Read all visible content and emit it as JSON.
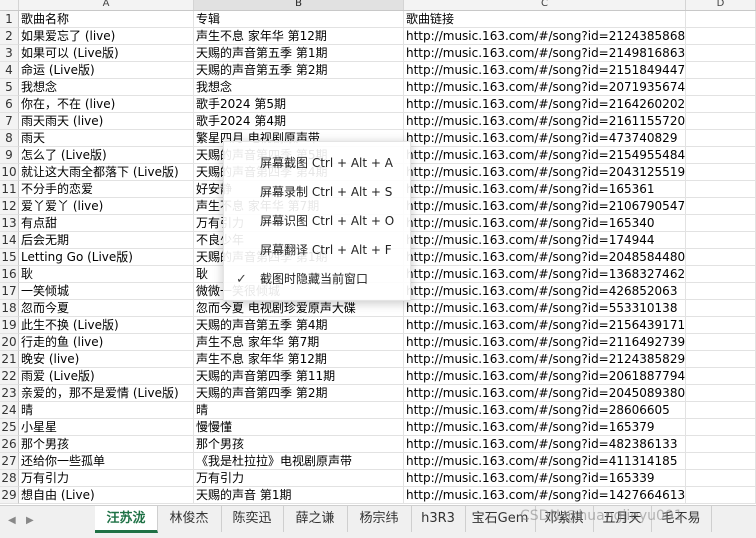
{
  "columns": [
    "A",
    "B",
    "C",
    "D"
  ],
  "selected_column": "B",
  "rows": [
    {
      "n": "1",
      "a": "歌曲名称",
      "b": "专辑",
      "c": "歌曲链接"
    },
    {
      "n": "2",
      "a": "如果爱忘了 (live)",
      "b": "声生不息 家年华 第12期",
      "c": "http://music.163.com/#/song?id=2124385868"
    },
    {
      "n": "3",
      "a": "如果可以 (Live版)",
      "b": "天赐的声音第五季 第1期",
      "c": "http://music.163.com/#/song?id=2149816863"
    },
    {
      "n": "4",
      "a": "命运 (Live版)",
      "b": "天赐的声音第五季 第2期",
      "c": "http://music.163.com/#/song?id=2151849447"
    },
    {
      "n": "5",
      "a": "我想念",
      "b": "我想念",
      "c": "http://music.163.com/#/song?id=2071935674"
    },
    {
      "n": "6",
      "a": "你在，不在 (live)",
      "b": "歌手2024 第5期",
      "c": "http://music.163.com/#/song?id=2164260202"
    },
    {
      "n": "7",
      "a": "雨天雨天 (live)",
      "b": "歌手2024 第4期",
      "c": "http://music.163.com/#/song?id=2161155720"
    },
    {
      "n": "8",
      "a": "雨天",
      "b": "繁星四月 电视剧原声带",
      "c": "http://music.163.com/#/song?id=473740829"
    },
    {
      "n": "9",
      "a": "怎么了 (Live版)",
      "b": "天赐的声音第四季 第5期",
      "c": "http://music.163.com/#/song?id=2154955484"
    },
    {
      "n": "10",
      "a": "就让这大雨全都落下 (Live版)",
      "b": "天赐的声音第四季 第4期",
      "c": "http://music.163.com/#/song?id=2043125519"
    },
    {
      "n": "11",
      "a": "不分手的恋爱",
      "b": "好安静",
      "c": "http://music.163.com/#/song?id=165361"
    },
    {
      "n": "12",
      "a": "爱丫爱丫 (live)",
      "b": "声生不息 家年华 第7期",
      "c": "http://music.163.com/#/song?id=2106790547"
    },
    {
      "n": "13",
      "a": "有点甜",
      "b": "万有引力",
      "c": "http://music.163.com/#/song?id=165340"
    },
    {
      "n": "14",
      "a": "后会无期",
      "b": "不良少年",
      "c": "http://music.163.com/#/song?id=174944"
    },
    {
      "n": "15",
      "a": "Letting Go (Live版)",
      "b": "天赐的声音第四季 第1期",
      "c": "http://music.163.com/#/song?id=2048584480"
    },
    {
      "n": "16",
      "a": "耿",
      "b": "耿",
      "c": "http://music.163.com/#/song?id=1368327462"
    },
    {
      "n": "17",
      "a": "一笑倾城",
      "b": "微微一笑很倾城",
      "c": "http://music.163.com/#/song?id=426852063"
    },
    {
      "n": "18",
      "a": "忽而今夏",
      "b": "忽而今夏 电视剧珍爱原声大碟",
      "c": "http://music.163.com/#/song?id=553310138"
    },
    {
      "n": "19",
      "a": "此生不换 (Live版)",
      "b": "天赐的声音第五季 第4期",
      "c": "http://music.163.com/#/song?id=2156439171"
    },
    {
      "n": "20",
      "a": "行走的鱼 (live)",
      "b": "声生不息 家年华 第7期",
      "c": "http://music.163.com/#/song?id=2116492739"
    },
    {
      "n": "21",
      "a": "晚安 (live)",
      "b": "声生不息 家年华 第12期",
      "c": "http://music.163.com/#/song?id=2124385829"
    },
    {
      "n": "22",
      "a": "雨爱 (Live版)",
      "b": "天赐的声音第四季 第11期",
      "c": "http://music.163.com/#/song?id=2061887794"
    },
    {
      "n": "23",
      "a": "亲爱的，那不是爱情 (Live版)",
      "b": "天赐的声音第四季 第2期",
      "c": "http://music.163.com/#/song?id=2045089380"
    },
    {
      "n": "24",
      "a": "晴",
      "b": "晴",
      "c": "http://music.163.com/#/song?id=28606605"
    },
    {
      "n": "25",
      "a": "小星星",
      "b": "慢慢懂",
      "c": "http://music.163.com/#/song?id=165379"
    },
    {
      "n": "26",
      "a": "那个男孩",
      "b": "那个男孩",
      "c": "http://music.163.com/#/song?id=482386133"
    },
    {
      "n": "27",
      "a": "还给你一些孤单",
      "b": "《我是杜拉拉》电视剧原声带",
      "c": "http://music.163.com/#/song?id=411314185"
    },
    {
      "n": "28",
      "a": "万有引力",
      "b": "万有引力",
      "c": "http://music.163.com/#/song?id=165339"
    },
    {
      "n": "29",
      "a": "想自由 (Live)",
      "b": "天赐的声音 第1期",
      "c": "http://music.163.com/#/song?id=1427664613"
    }
  ],
  "context_menu": {
    "items": [
      {
        "label": "屏幕截图 Ctrl + Alt + A",
        "checked": false
      },
      {
        "label": "屏幕录制 Ctrl + Alt + S",
        "checked": false
      },
      {
        "label": "屏幕识图 Ctrl + Alt + O",
        "checked": false
      },
      {
        "label": "屏幕翻译 Ctrl + Alt + F",
        "checked": false
      },
      {
        "label": "截图时隐藏当前窗口",
        "checked": true
      }
    ]
  },
  "sheet_tabs": [
    {
      "label": "汪苏泷",
      "active": true
    },
    {
      "label": "林俊杰",
      "active": false
    },
    {
      "label": "陈奕迅",
      "active": false
    },
    {
      "label": "薛之谦",
      "active": false
    },
    {
      "label": "杨宗纬",
      "active": false
    },
    {
      "label": "h3R3",
      "active": false
    },
    {
      "label": "宝石Gem",
      "active": false
    },
    {
      "label": "邓紫棋",
      "active": false
    },
    {
      "label": "五月天",
      "active": false
    },
    {
      "label": "毛不易",
      "active": false
    }
  ],
  "watermark": "CSDN @huangjieyu001",
  "colors": {
    "accent": "#1e7145",
    "header_bg": "#f3f3f3",
    "grid_line": "#e2e2e2"
  }
}
